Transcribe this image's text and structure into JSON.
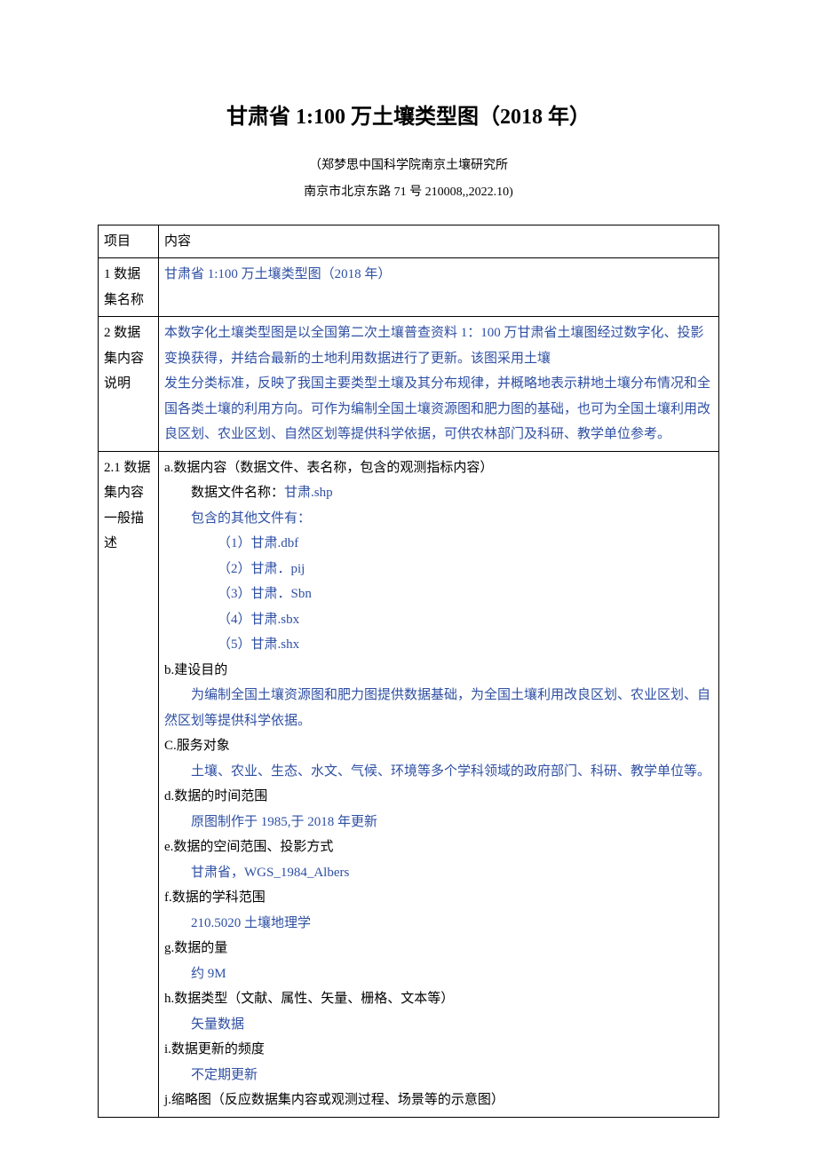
{
  "title": "甘肃省 1:100 万土壤类型图（2018 年）",
  "author": "（郑梦思中国科学院南京土壤研究所",
  "address": "南京市北京东路 71 号 210008,,2022.10)",
  "table": {
    "headers": {
      "col1": "项目",
      "col2": "内容"
    },
    "row1": {
      "label": "1 数据集名称",
      "content": "甘肃省 1:100 万土壤类型图（2018 年）"
    },
    "row2": {
      "label": "2 数据集内容说明",
      "p1": "本数字化土壤类型图是以全国第二次土壤普查资料 1：100 万甘肃省土壤图经过数字化、投影变换获得，并结合最新的土地利用数据进行了更新。该图采用土壤",
      "p2": "发生分类标准，反映了我国主要类型土壤及其分布规律，并概略地表示耕地土壤分布情况和全国各类土壤的利用方向。可作为编制全国土壤资源图和肥力图的基础，也可为全国土壤利用改良区划、农业区划、自然区划等提供科学依据，可供农林部门及科研、教学单位参考。"
    },
    "row3": {
      "label": "2.1 数据集内容一般描述",
      "a_head": "a.数据内容（数据文件、表名称，包含的观测指标内容）",
      "a_file_label": "数据文件名称：",
      "a_file": "甘肃.shp",
      "a_other": "包含的其他文件有：",
      "files": [
        "（1）甘肃.dbf",
        "（2）甘肃．pij",
        "（3）甘肃．Sbn",
        "（4）甘肃.sbx",
        "（5）甘肃.shx"
      ],
      "b_head": "b.建设目的",
      "b_body": "为编制全国土壤资源图和肥力图提供数据基础，为全国土壤利用改良区划、农业区划、自然区划等提供科学依据。",
      "c_head": "C.服务对象",
      "c_body": "土壤、农业、生态、水文、气候、环境等多个学科领域的政府部门、科研、教学单位等。",
      "d_head": "d.数据的时间范围",
      "d_body": "原图制作于 1985,于 2018 年更新",
      "e_head": "e.数据的空间范围、投影方式",
      "e_body": "甘肃省，WGS_1984_Albers",
      "f_head": "f.数据的学科范围",
      "f_body": "210.5020 土壤地理学",
      "g_head": "g.数据的量",
      "g_body": "约 9M",
      "h_head": "h.数据类型（文献、属性、矢量、栅格、文本等）",
      "h_body": "矢量数据",
      "i_head": "i.数据更新的频度",
      "i_body": "不定期更新",
      "j_head": "j.缩略图（反应数据集内容或观测过程、场景等的示意图）"
    }
  }
}
